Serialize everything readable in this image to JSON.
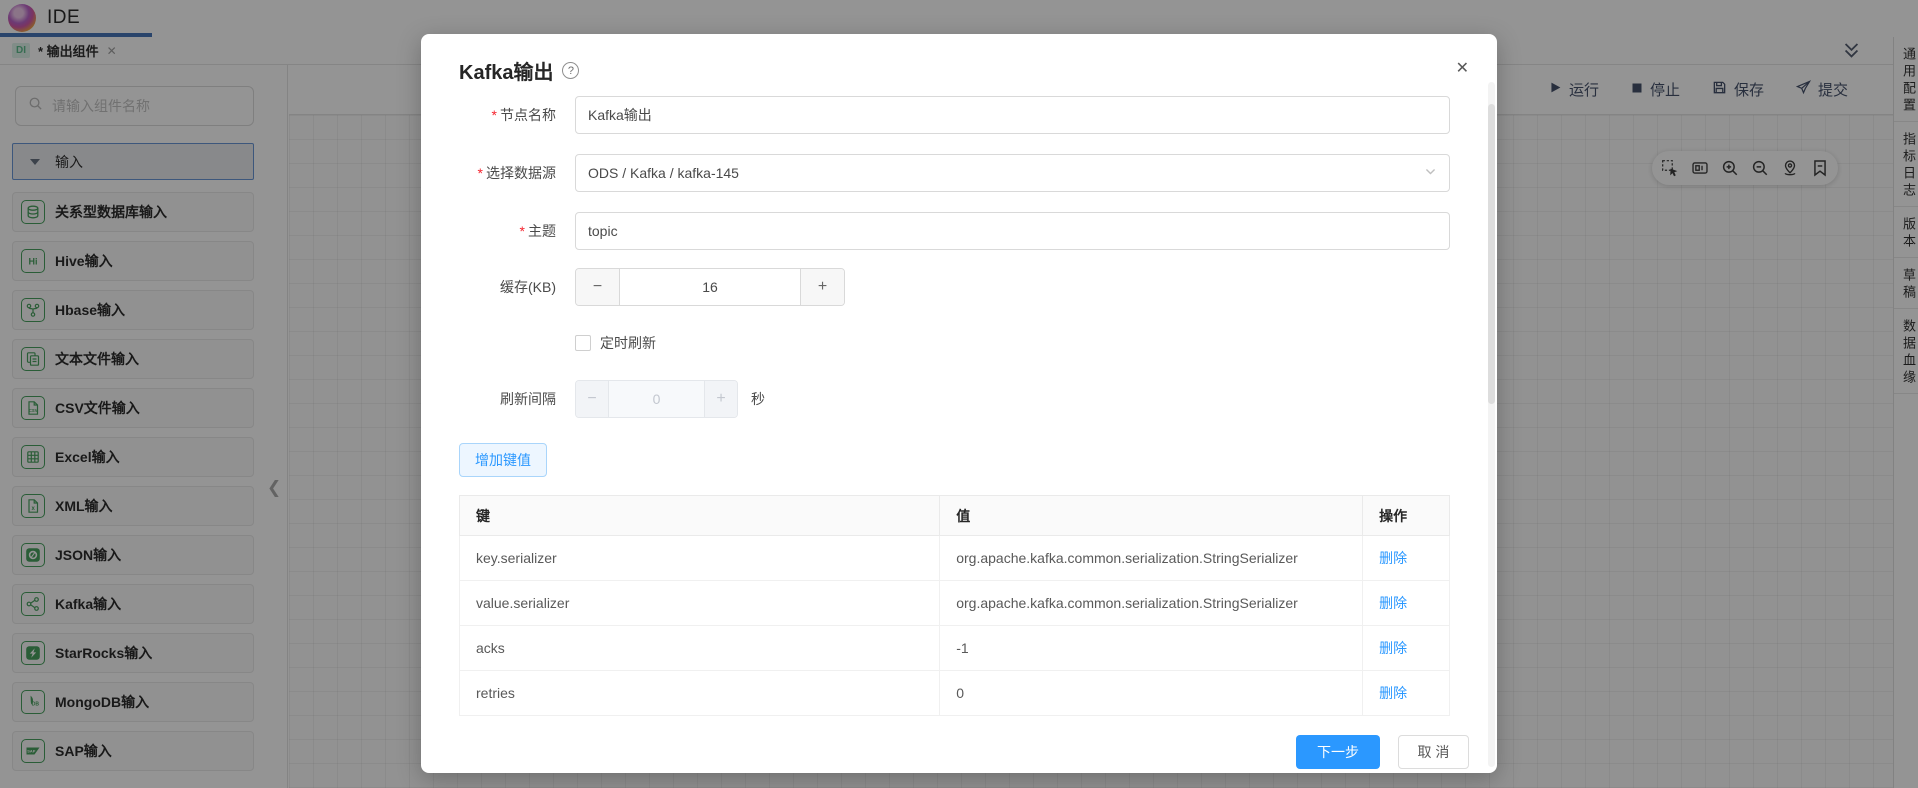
{
  "app": {
    "title": "IDE"
  },
  "tabbar": {
    "badge": "DI",
    "tab": "* 输出组件",
    "close": "✕"
  },
  "toolbar": {
    "run": "运行",
    "stop": "停止",
    "save": "保存",
    "submit": "提交"
  },
  "sidebar": {
    "search_placeholder": "请输入组件名称",
    "group": "输入",
    "items": [
      {
        "label": "关系型数据库输入",
        "icon": "database-icon"
      },
      {
        "label": "Hive输入",
        "icon": "hive-icon"
      },
      {
        "label": "Hbase输入",
        "icon": "hbase-icon"
      },
      {
        "label": "文本文件输入",
        "icon": "text-file-icon"
      },
      {
        "label": "CSV文件输入",
        "icon": "csv-file-icon"
      },
      {
        "label": "Excel输入",
        "icon": "excel-icon"
      },
      {
        "label": "XML输入",
        "icon": "xml-file-icon"
      },
      {
        "label": "JSON输入",
        "icon": "json-icon"
      },
      {
        "label": "Kafka输入",
        "icon": "kafka-icon"
      },
      {
        "label": "StarRocks输入",
        "icon": "starrocks-icon"
      },
      {
        "label": "MongoDB输入",
        "icon": "mongodb-icon"
      },
      {
        "label": "SAP输入",
        "icon": "sap-icon"
      }
    ]
  },
  "right_panel": {
    "tabs": [
      "通用配置",
      "指标日志",
      "版本",
      "草稿",
      "数据血缘"
    ]
  },
  "modal": {
    "title": "Kafka输出",
    "close": "✕",
    "required_mark": "*",
    "fields": {
      "node_name": {
        "label": "节点名称",
        "value": "Kafka输出"
      },
      "datasource": {
        "label": "选择数据源",
        "value": "ODS / Kafka / kafka-145"
      },
      "topic": {
        "label": "主题",
        "value": "topic"
      },
      "buffer": {
        "label": "缓存(KB)",
        "value": "16",
        "minus": "−",
        "plus": "+"
      },
      "timed_refresh": {
        "label": "定时刷新"
      },
      "interval": {
        "label": "刷新间隔",
        "value": "0",
        "unit": "秒",
        "minus": "−",
        "plus": "+"
      }
    },
    "add_button": "增加键值",
    "table": {
      "headers": [
        "键",
        "值",
        "操作"
      ],
      "delete_label": "删除",
      "rows": [
        {
          "key": "key.serializer",
          "value": "org.apache.kafka.common.serialization.StringSerializer"
        },
        {
          "key": "value.serializer",
          "value": "org.apache.kafka.common.serialization.StringSerializer"
        },
        {
          "key": "acks",
          "value": "-1"
        },
        {
          "key": "retries",
          "value": "0"
        }
      ]
    },
    "footer": {
      "next": "下一步",
      "cancel": "取 消"
    }
  },
  "colors": {
    "primary": "#2b98ff",
    "icon_green": "#3f9c57",
    "required": "#f5222d",
    "tab_indicator": "#3d6eb4",
    "badge_bg": "#dcf3e9",
    "badge_text": "#57b887"
  }
}
